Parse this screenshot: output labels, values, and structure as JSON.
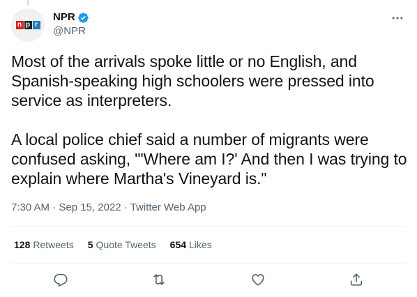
{
  "author": {
    "display_name": "NPR",
    "handle": "@NPR",
    "verified": true,
    "avatar_logo": [
      "n",
      "p",
      "r"
    ]
  },
  "tweet": {
    "text": "Most of the arrivals spoke little or no English, and Spanish-speaking high schoolers were pressed into service as interpreters.\n\nA local police chief said a number of migrants were confused asking, \"'Where am I?' And then I was trying to explain where Martha's Vineyard is.\""
  },
  "meta": {
    "time": "7:30 AM",
    "separator": " · ",
    "date": "Sep 15, 2022",
    "source": "Twitter Web App"
  },
  "stats": {
    "retweets": {
      "count": "128",
      "label": "Retweets"
    },
    "quotes": {
      "count": "5",
      "label": "Quote Tweets"
    },
    "likes": {
      "count": "654",
      "label": "Likes"
    }
  },
  "actions": [
    "reply-icon",
    "retweet-icon",
    "like-icon",
    "share-icon"
  ],
  "colors": {
    "verified": "#1d9bf0",
    "muted": "#536471",
    "icon": "#536471",
    "divider": "#eff3f4"
  }
}
